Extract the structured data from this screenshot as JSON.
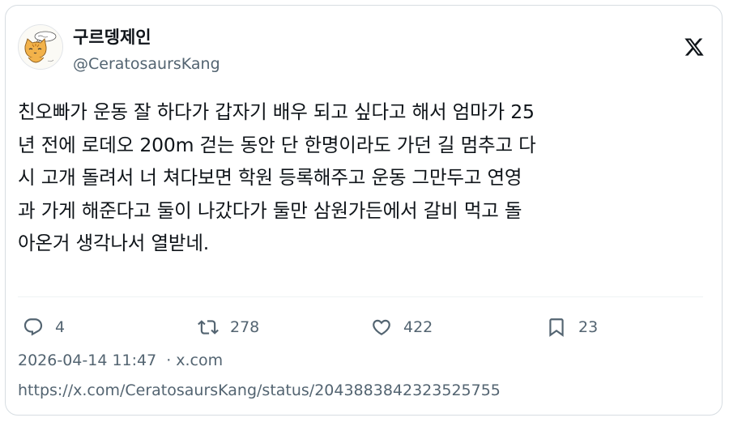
{
  "author": {
    "display_name": "구르뎅제인",
    "handle": "@CeratosaursKang"
  },
  "tweet": {
    "lines": [
      "친오빠가 운동 잘 하다가 갑자기 배우 되고 싶다고 해서 엄마가 25",
      "년 전에 로데오 200m 걷는 동안 단 한명이라도 가던 길 멈추고 다",
      "시 고개 돌려서 너 쳐다보면 학원 등록해주고 운동 그만두고 연영",
      "과 가게 해준다고 둘이 나갔다가 둘만 삼원가든에서 갈비 먹고 돌",
      "아온거 생각나서 열받네."
    ]
  },
  "actions": {
    "replies": "4",
    "retweets": "278",
    "likes": "422",
    "bookmarks": "23"
  },
  "meta": {
    "timestamp": "2026-04-14 11:47",
    "separator": "·",
    "source": "x.com"
  },
  "url": "https://x.com/CeratosaursKang/status/2043883842323525755",
  "icons": {
    "reply": "speech-bubble-icon",
    "retweet": "retweet-arrows-icon",
    "like": "heart-icon",
    "bookmark": "bookmark-icon",
    "brand": "x-logo-icon"
  },
  "colors": {
    "text": "#0f1419",
    "secondary": "#536471",
    "border": "#d7dde2"
  }
}
